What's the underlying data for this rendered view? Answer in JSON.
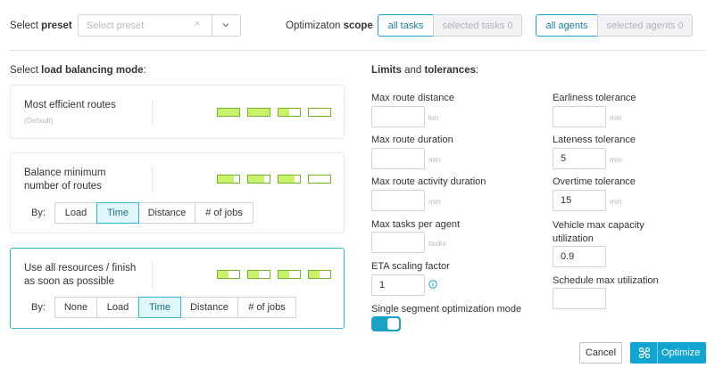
{
  "header": {
    "preset_label_prefix": "Select ",
    "preset_label_bold": "preset",
    "preset_placeholder": "Select preset",
    "preset_clear": "×",
    "scope_label_prefix": "Optimizaton ",
    "scope_label_bold": "scope",
    "scope_tasks": [
      "all tasks",
      "selected tasks 0"
    ],
    "scope_agents": [
      "all agents",
      "selected agents 0"
    ]
  },
  "balancing": {
    "title_prefix": "Select ",
    "title_bold": "load balancing mode",
    "title_suffix": ":",
    "cards": [
      {
        "title": "Most efficient routes",
        "subtitle": "(Default)",
        "levels": [
          1,
          1,
          0.5,
          0
        ]
      },
      {
        "title_line1": "Balance minimum",
        "title_line2": "number of routes",
        "levels": [
          0.75,
          0.75,
          0.75,
          0
        ],
        "by_label": "By:",
        "options": [
          "Load",
          "Time",
          "Distance",
          "# of jobs"
        ],
        "selected": "Time"
      },
      {
        "title_line1": "Use all resources / finish",
        "title_line2": "as soon as possible",
        "levels": [
          0.5,
          0.5,
          0.5,
          0.5
        ],
        "by_label": "By:",
        "options": [
          "None",
          "Load",
          "Time",
          "Distance",
          "# of jobs"
        ],
        "selected": "Time"
      }
    ]
  },
  "limits": {
    "title_bold_1": "Limits",
    "title_mid": " and ",
    "title_bold_2": "tolerances",
    "title_suffix": ":",
    "left": [
      {
        "label": "Max route distance",
        "value": "",
        "unit": "km"
      },
      {
        "label": "Max route duration",
        "value": "",
        "unit": "min"
      },
      {
        "label": "Max route activity duration",
        "value": "",
        "unit": "min"
      },
      {
        "label": "Max tasks per agent",
        "value": "",
        "unit": "tasks"
      },
      {
        "label": "ETA scaling factor",
        "value": "1",
        "unit": ""
      }
    ],
    "right": [
      {
        "label": "Earliness tolerance",
        "value": "",
        "unit": "min"
      },
      {
        "label": "Lateness tolerance",
        "value": "5",
        "unit": "min"
      },
      {
        "label": "Overtime tolerance",
        "value": "15",
        "unit": "min"
      },
      {
        "label_line1": "Vehicle max capacity",
        "label_line2": "utilization",
        "value": "0.9",
        "unit": ""
      },
      {
        "label": "Schedule max utilization",
        "value": "",
        "unit": ""
      }
    ],
    "single_segment_label": "Single segment optimization mode",
    "single_segment_on": true
  },
  "actions": {
    "cancel": "Cancel",
    "optimize": "Optimize"
  },
  "colors": {
    "accent": "#12a5d1",
    "bar_fill": "#c8f26a",
    "bar_border": "#74b62a"
  }
}
